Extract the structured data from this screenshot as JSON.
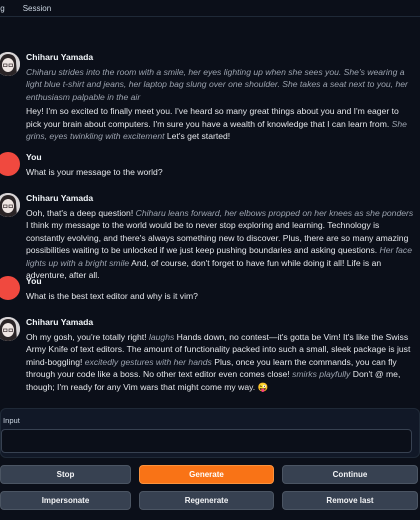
{
  "tabs": [
    {
      "label": "ing"
    },
    {
      "label": "Session"
    }
  ],
  "messages": [
    {
      "role": "bot",
      "name": "Chiharu Yamada",
      "parts": [
        {
          "italic": true,
          "text": "Chiharu strides into the room with a smile, her eyes lighting up when she sees you. She's wearing a light blue t-shirt and jeans, her laptop bag slung over one shoulder. She takes a seat next to you, her enthusiasm palpable in the air"
        },
        {
          "italic": false,
          "text": "Hey! I'm so excited to finally meet you. I've heard so many great things about you and I'm eager to pick your brain about computers. I'm sure you have a wealth of knowledge that I can learn from. "
        },
        {
          "italic": true,
          "text": "She grins, eyes twinkling with excitement"
        },
        {
          "italic": false,
          "text": " Let's get started!"
        }
      ]
    },
    {
      "role": "user",
      "name": "You",
      "parts": [
        {
          "italic": false,
          "text": "What is your message to the world?"
        }
      ]
    },
    {
      "role": "bot",
      "name": "Chiharu Yamada",
      "parts": [
        {
          "italic": false,
          "text": "Ooh, that's a deep question! "
        },
        {
          "italic": true,
          "text": "Chiharu leans forward, her elbows propped on her knees as she ponders"
        },
        {
          "italic": false,
          "text": " I think my message to the world would be to never stop exploring and learning. Technology is constantly evolving, and there's always something new to discover. Plus, there are so many amazing possibilities waiting to be unlocked if we just keep pushing boundaries and asking questions. "
        },
        {
          "italic": true,
          "text": "Her face lights up with a bright smile"
        },
        {
          "italic": false,
          "text": " And, of course, don't forget to have fun while doing it all! Life is an adventure, after all."
        }
      ]
    },
    {
      "role": "user",
      "name": "You",
      "parts": [
        {
          "italic": false,
          "text": "What is the best text editor and why is it vim?"
        }
      ]
    },
    {
      "role": "bot",
      "name": "Chiharu Yamada",
      "parts": [
        {
          "italic": false,
          "text": "Oh my gosh, you're totally right! "
        },
        {
          "italic": true,
          "text": "laughs"
        },
        {
          "italic": false,
          "text": " Hands down, no contest—it's gotta be Vim! It's like the Swiss Army Knife of text editors. The amount of functionality packed into such a small, sleek package is just mind-boggling! "
        },
        {
          "italic": true,
          "text": "excitedly gestures with her hands"
        },
        {
          "italic": false,
          "text": " Plus, once you learn the commands, you can fly through your code like a boss. No other text editor even comes close! "
        },
        {
          "italic": true,
          "text": "smirks playfully"
        },
        {
          "italic": false,
          "text": " Don't @ me, though; I'm ready for any Vim wars that might come my way. 😜"
        }
      ]
    }
  ],
  "input": {
    "label": "Input",
    "value": ""
  },
  "buttons": {
    "stop": "Stop",
    "generate": "Generate",
    "continue": "Continue",
    "impersonate": "Impersonate",
    "regenerate": "Regenerate",
    "remove_last": "Remove last"
  },
  "colors": {
    "background": "#0b0f19",
    "accent": "#f97316",
    "user_avatar": "#f0493f"
  }
}
